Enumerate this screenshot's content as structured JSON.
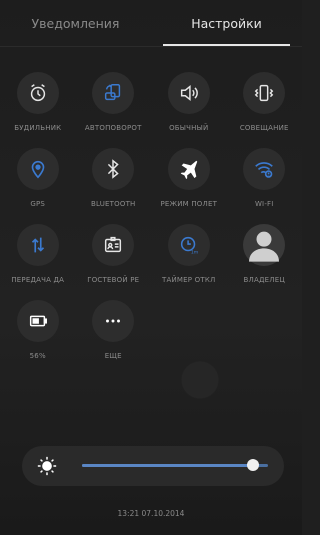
{
  "tabs": [
    {
      "label": "Уведомления",
      "active": false
    },
    {
      "label": "Настройки",
      "active": true
    }
  ],
  "tiles": [
    {
      "label": "БУДИЛЬНИК",
      "icon": "alarm-clock-icon",
      "color": "#e6e6e6"
    },
    {
      "label": "АВТОПОВОРОТ",
      "icon": "auto-rotate-icon",
      "color": "#3b7ad0"
    },
    {
      "label": "ОБЫЧНЫЙ",
      "icon": "sound-on-icon",
      "color": "#e6e6e6"
    },
    {
      "label": "СОВЕЩАНИЕ",
      "icon": "vibrate-icon",
      "color": "#e6e6e6"
    },
    {
      "label": "GPS",
      "icon": "location-icon",
      "color": "#3b7ad0"
    },
    {
      "label": "BLUETOOTH",
      "icon": "bluetooth-icon",
      "color": "#e6e6e6"
    },
    {
      "label": "РЕЖИМ ПОЛЕТ",
      "icon": "airplane-icon",
      "color": "#ffffff"
    },
    {
      "label": "WI-FI",
      "icon": "wifi-icon",
      "color": "#3b7ad0"
    },
    {
      "label": "ПЕРЕДАЧА ДА",
      "icon": "data-transfer-icon",
      "color": "#3b7ad0"
    },
    {
      "label": "ГОСТЕВОЙ РЕ",
      "icon": "guest-mode-icon",
      "color": "#e6e6e6"
    },
    {
      "label": "ТАЙМЕР ОТКЛ",
      "icon": "sleep-timer-icon",
      "color": "#3b7ad0"
    },
    {
      "label": "ВЛАДЕЛЕЦ",
      "icon": "owner-avatar-icon",
      "color": "#cfcfcf"
    },
    {
      "label": "56%",
      "icon": "battery-icon",
      "color": "#ffffff"
    },
    {
      "label": "ЕЩЕ",
      "icon": "more-icon",
      "color": "#ffffff"
    }
  ],
  "brightness": {
    "level": 0.92,
    "icon": "sun-icon"
  },
  "timestamp": "13:21 07.10.2014",
  "colors": {
    "accent": "#3b7ad0",
    "background": "#1f1f1f",
    "tile": "#2d2d2d"
  }
}
